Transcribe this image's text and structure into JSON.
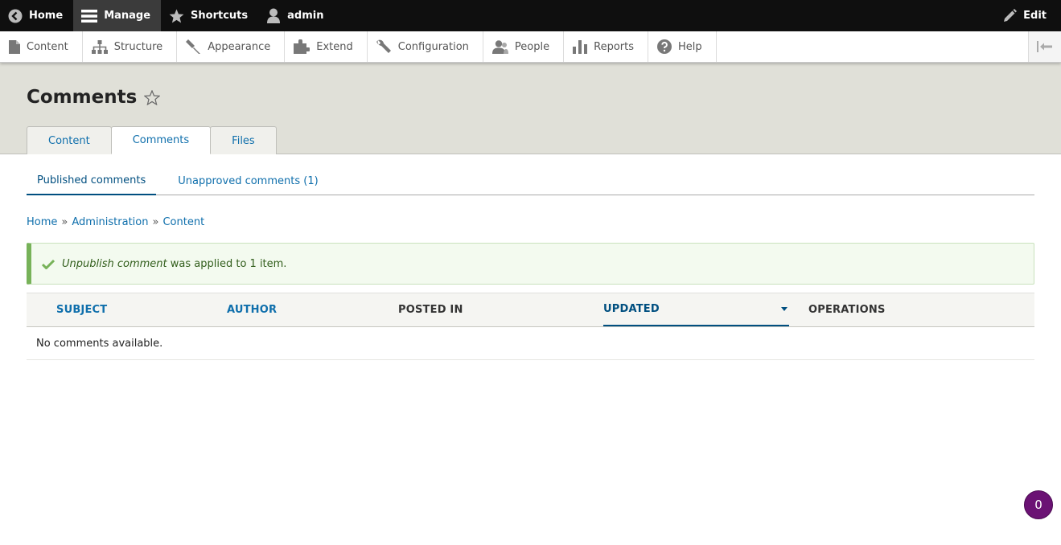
{
  "toolbar": {
    "home": "Home",
    "manage": "Manage",
    "shortcuts": "Shortcuts",
    "user": "admin",
    "edit": "Edit"
  },
  "tray": {
    "items": [
      "Content",
      "Structure",
      "Appearance",
      "Extend",
      "Configuration",
      "People",
      "Reports",
      "Help"
    ]
  },
  "page": {
    "title": "Comments"
  },
  "tabs": [
    "Content",
    "Comments",
    "Files"
  ],
  "subtabs": [
    "Published comments",
    "Unapproved comments (1)"
  ],
  "breadcrumb": [
    "Home",
    "Administration",
    "Content"
  ],
  "breadcrumb_separator": "»",
  "message": {
    "emphasis": "Unpublish comment",
    "rest": " was applied to 1 item."
  },
  "table": {
    "headers": [
      "Subject",
      "Author",
      "Posted in",
      "Updated",
      "Operations"
    ],
    "empty": "No comments available."
  },
  "badge": {
    "count": "0"
  },
  "colors": {
    "accent": "#0f6fac",
    "success": "#77b259",
    "badge": "#6b1274"
  }
}
